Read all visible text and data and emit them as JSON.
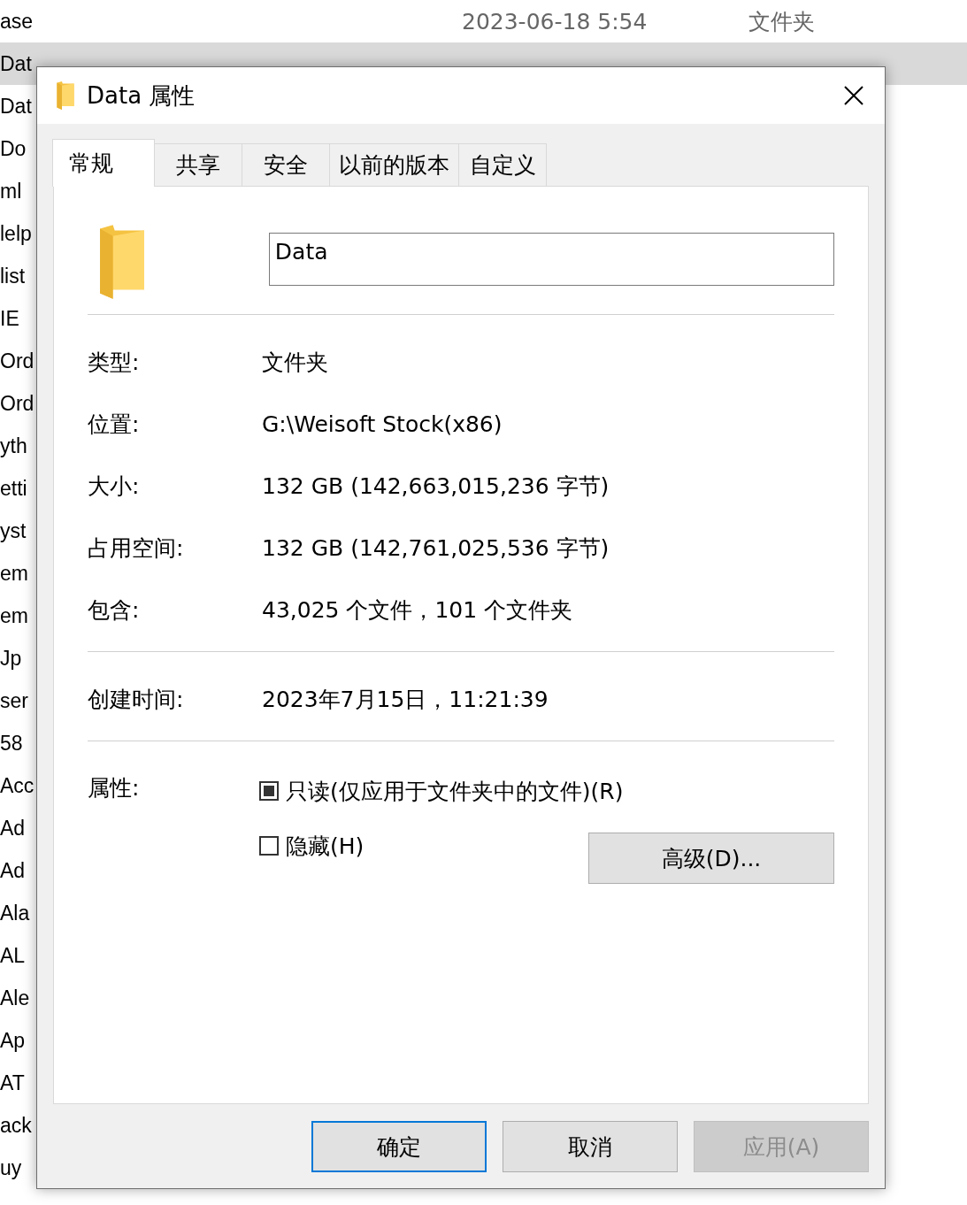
{
  "file_list": {
    "rows": [
      {
        "name": "ase",
        "modified": "2023-06-18 5:54",
        "type": "文件夹",
        "selected": false
      },
      {
        "name": "Dat",
        "selected": true
      },
      {
        "name": "Dat",
        "selected": false
      },
      {
        "name": "Do",
        "selected": false
      },
      {
        "name": "ml",
        "selected": false
      },
      {
        "name": "lelp",
        "selected": false
      },
      {
        "name": "list",
        "selected": false
      },
      {
        "name": "IE",
        "selected": false
      },
      {
        "name": "Ord",
        "selected": false
      },
      {
        "name": "Ord",
        "selected": false
      },
      {
        "name": "yth",
        "selected": false
      },
      {
        "name": "etti",
        "selected": false
      },
      {
        "name": "yst",
        "selected": false
      },
      {
        "name": "em",
        "selected": false
      },
      {
        "name": "em",
        "selected": false
      },
      {
        "name": "Jp",
        "selected": false
      },
      {
        "name": "ser",
        "selected": false
      },
      {
        "name": "58",
        "selected": false
      },
      {
        "name": "Acc",
        "selected": false
      },
      {
        "name": "Ad",
        "selected": false
      },
      {
        "name": "Ad",
        "selected": false
      },
      {
        "name": "Ala",
        "selected": false
      },
      {
        "name": "AL",
        "selected": false
      },
      {
        "name": "Ale",
        "selected": false
      },
      {
        "name": "Ap",
        "selected": false
      },
      {
        "name": "AT",
        "selected": false
      },
      {
        "name": "ack",
        "selected": false
      },
      {
        "name": "uy",
        "selected": false
      }
    ]
  },
  "dialog": {
    "title": "Data 属性",
    "tabs": [
      {
        "label": "常规",
        "selected": true
      },
      {
        "label": "共享",
        "selected": false
      },
      {
        "label": "安全",
        "selected": false
      },
      {
        "label": "以前的版本",
        "selected": false
      },
      {
        "label": "自定义",
        "selected": false
      }
    ],
    "name_value": "Data",
    "groups": [
      [
        {
          "label": "类型:",
          "value": "文件夹"
        },
        {
          "label": "位置:",
          "value": "G:\\Weisoft Stock(x86)"
        },
        {
          "label": "大小:",
          "value": "132 GB (142,663,015,236 字节)"
        },
        {
          "label": "占用空间:",
          "value": "132 GB (142,761,025,536 字节)"
        },
        {
          "label": "包含:",
          "value": "43,025 个文件，101 个文件夹"
        }
      ],
      [
        {
          "label": "创建时间:",
          "value": "2023年7月15日，11:21:39"
        }
      ]
    ],
    "attributes_label": "属性:",
    "attributes": [
      {
        "label": "只读(仅应用于文件夹中的文件)(R)",
        "checked": true
      },
      {
        "label": "隐藏(H)",
        "checked": false
      }
    ],
    "advanced_button": "高级(D)...",
    "buttons": [
      {
        "label": "确定",
        "default": true,
        "disabled": false
      },
      {
        "label": "取消",
        "default": false,
        "disabled": false
      },
      {
        "label": "应用(A)",
        "default": false,
        "disabled": true
      }
    ]
  }
}
